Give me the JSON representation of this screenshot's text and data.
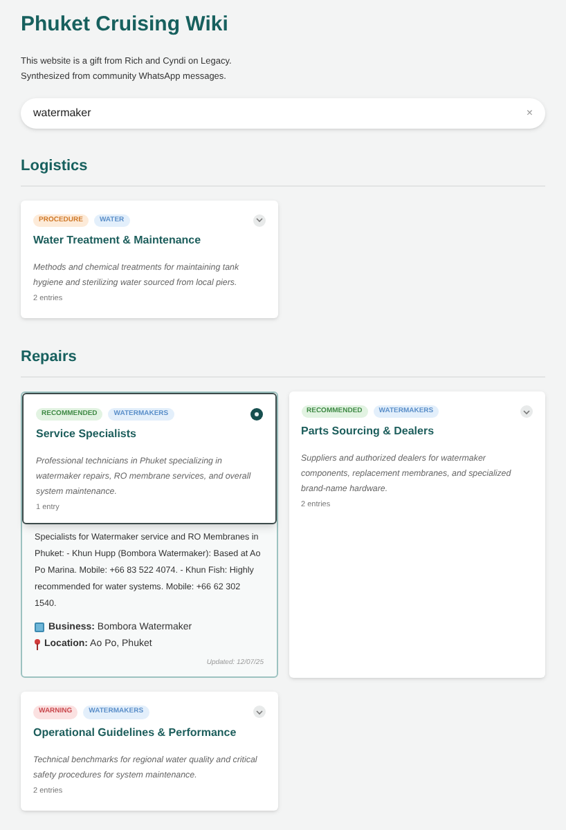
{
  "title": "Phuket Cruising Wiki",
  "intro": [
    "This website is a gift from Rich and Cyndi on Legacy.",
    "Synthesized from community WhatsApp messages."
  ],
  "search": {
    "value": "watermaker",
    "clear": "×"
  },
  "sections": [
    {
      "heading": "Logistics",
      "cards": [
        {
          "tags": [
            {
              "label": "PROCEDURE",
              "kind": "procedure"
            },
            {
              "label": "WATER",
              "kind": "topic"
            }
          ],
          "title": "Water Treatment & Maintenance",
          "description": "Methods and chemical treatments for maintaining tank hygiene and sterilizing water sourced from local piers.",
          "count": "2 entries",
          "expanded": false
        }
      ]
    },
    {
      "heading": "Repairs",
      "cards": [
        {
          "tags": [
            {
              "label": "RECOMMENDED",
              "kind": "recommended"
            },
            {
              "label": "WATERMAKERS",
              "kind": "topic"
            }
          ],
          "title": "Service Specialists",
          "description": "Professional technicians in Phuket specializing in watermaker repairs, RO membrane services, and overall system maintenance.",
          "count": "1 entry",
          "expanded": true,
          "detail": {
            "text": "Specialists for Watermaker service and RO Membranes in Phuket: - Khun Hupp (Bombora Watermaker): Based at Ao Po Marina. Mobile: +66 83 522 4074. - Khun Fish: Highly recommended for water systems. Mobile: +66 62 302 1540.",
            "business_label": "Business:",
            "business": "Bombora Watermaker",
            "location_label": "Location:",
            "location": "Ao Po, Phuket",
            "updated": "Updated: 12/07/25"
          }
        },
        {
          "tags": [
            {
              "label": "RECOMMENDED",
              "kind": "recommended"
            },
            {
              "label": "WATERMAKERS",
              "kind": "topic"
            }
          ],
          "title": "Parts Sourcing & Dealers",
          "description": "Suppliers and authorized dealers for watermaker components, replacement membranes, and specialized brand-name hardware.",
          "count": "2 entries",
          "expanded": false
        },
        {
          "tags": [
            {
              "label": "WARNING",
              "kind": "warning"
            },
            {
              "label": "WATERMAKERS",
              "kind": "topic"
            }
          ],
          "title": "Operational Guidelines & Performance",
          "description": "Technical benchmarks for regional water quality and critical safety procedures for system maintenance.",
          "count": "2 entries",
          "expanded": false
        }
      ]
    }
  ]
}
